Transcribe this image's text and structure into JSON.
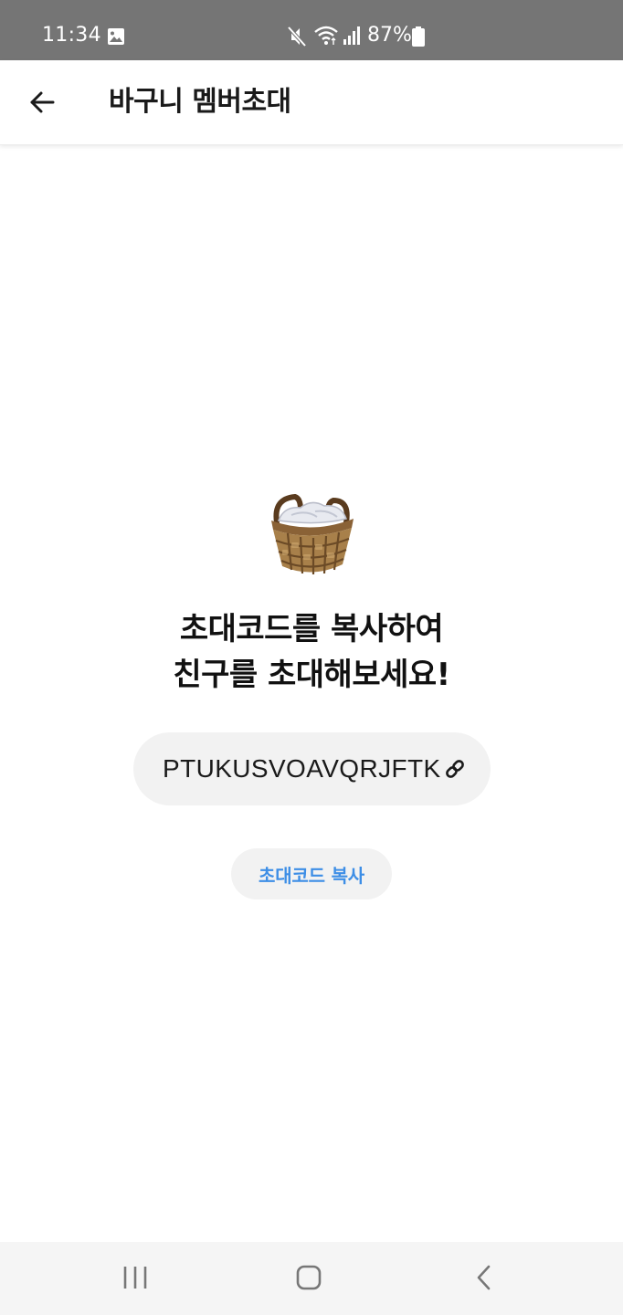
{
  "status_bar": {
    "time": "11:34",
    "battery": "87%",
    "icons": [
      "image-icon",
      "mute-icon",
      "wifi-icon",
      "signal-icon",
      "battery-icon"
    ]
  },
  "app_bar": {
    "back_icon": "arrow-left-icon",
    "title": "바구니 멤버초대"
  },
  "content": {
    "emoji": "basket-icon",
    "headline_line1": "초대코드를 복사하여",
    "headline_line2": "친구를 초대해보세요!",
    "invite_code": "PTUKUSVOAVQRJFTK",
    "link_icon": "link-icon",
    "copy_button_label": "초대코드 복사"
  },
  "nav_bar": {
    "icons": [
      "recent-apps-icon",
      "home-icon",
      "back-icon"
    ]
  },
  "colors": {
    "status_bar_bg": "#757575",
    "accent_blue": "#3d8ee6",
    "pill_bg": "#f2f2f2",
    "nav_bg": "#f5f5f5"
  }
}
